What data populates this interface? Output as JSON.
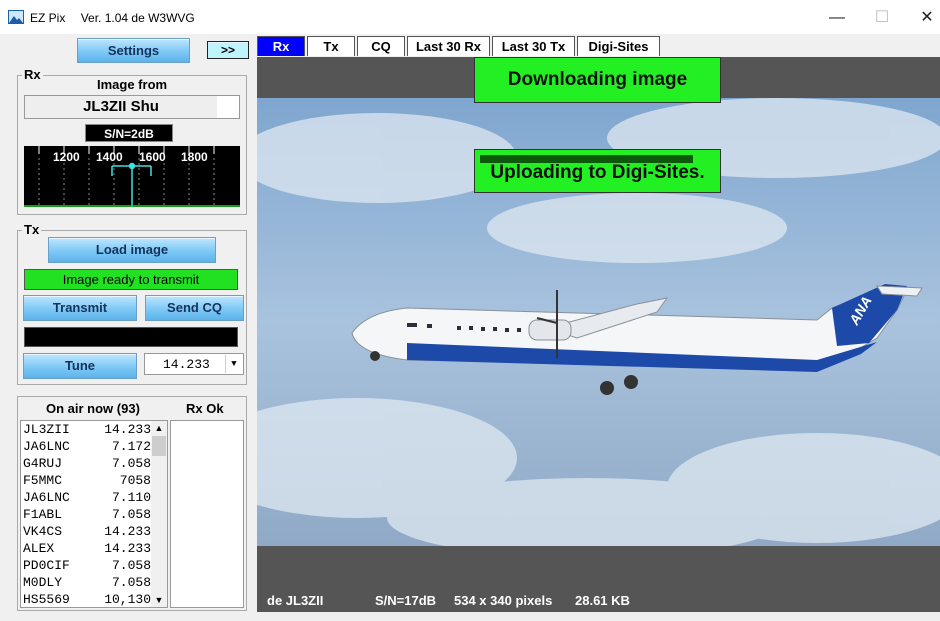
{
  "window": {
    "app_name": "EZ Pix",
    "version": "Ver. 1.04 de W3WVG",
    "controls": {
      "minimize": "—",
      "maximize": "☐",
      "close": "✕"
    }
  },
  "left": {
    "settings_label": "Settings",
    "expand_label": ">>",
    "rx": {
      "group_label": "Rx",
      "image_from_label": "Image from",
      "callsign": "JL3ZII  Shu",
      "sn": "S/N=2dB",
      "scope_ticks": [
        "1200",
        "1400",
        "1600",
        "1800"
      ]
    },
    "tx": {
      "group_label": "Tx",
      "load_image_label": "Load image",
      "status": "Image ready to transmit",
      "transmit_label": "Transmit",
      "send_cq_label": "Send CQ",
      "tune_label": "Tune",
      "frequency": "14.233"
    },
    "on_air": {
      "header": "On air now (93)",
      "rx_ok_header": "Rx Ok",
      "stations": [
        {
          "call": "JL3ZII",
          "freq": "14.233"
        },
        {
          "call": "JA6LNC",
          "freq": "7.172"
        },
        {
          "call": "G4RUJ",
          "freq": "7.058"
        },
        {
          "call": "F5MMC",
          "freq": "7058"
        },
        {
          "call": "JA6LNC",
          "freq": "7.110"
        },
        {
          "call": "F1ABL",
          "freq": "7.058"
        },
        {
          "call": "VK4CS",
          "freq": "14.233"
        },
        {
          "call": "ALEX",
          "freq": "14.233"
        },
        {
          "call": "PD0CIF",
          "freq": "7.058"
        },
        {
          "call": "M0DLY",
          "freq": "7.058"
        },
        {
          "call": "HS5569",
          "freq": "10,130"
        }
      ]
    }
  },
  "tabs": [
    {
      "label": "Rx",
      "active": true
    },
    {
      "label": "Tx",
      "active": false
    },
    {
      "label": "CQ",
      "active": false
    },
    {
      "label": "Last 30 Rx",
      "active": false
    },
    {
      "label": "Last 30 Tx",
      "active": false
    },
    {
      "label": "Digi-Sites",
      "active": false
    }
  ],
  "viewer": {
    "download_banner": "Downloading image",
    "upload_banner": "Uploading to Digi-Sites.",
    "aircraft_livery": "ANA",
    "status": {
      "from": "de JL3ZII",
      "sn": "S/N=17dB",
      "dimensions": "534 x 340 pixels",
      "size": "28.61 KB"
    }
  },
  "colors": {
    "accent_blue": "#0000ff",
    "status_green": "#22e022",
    "button_blue": "#7ec8f5"
  }
}
